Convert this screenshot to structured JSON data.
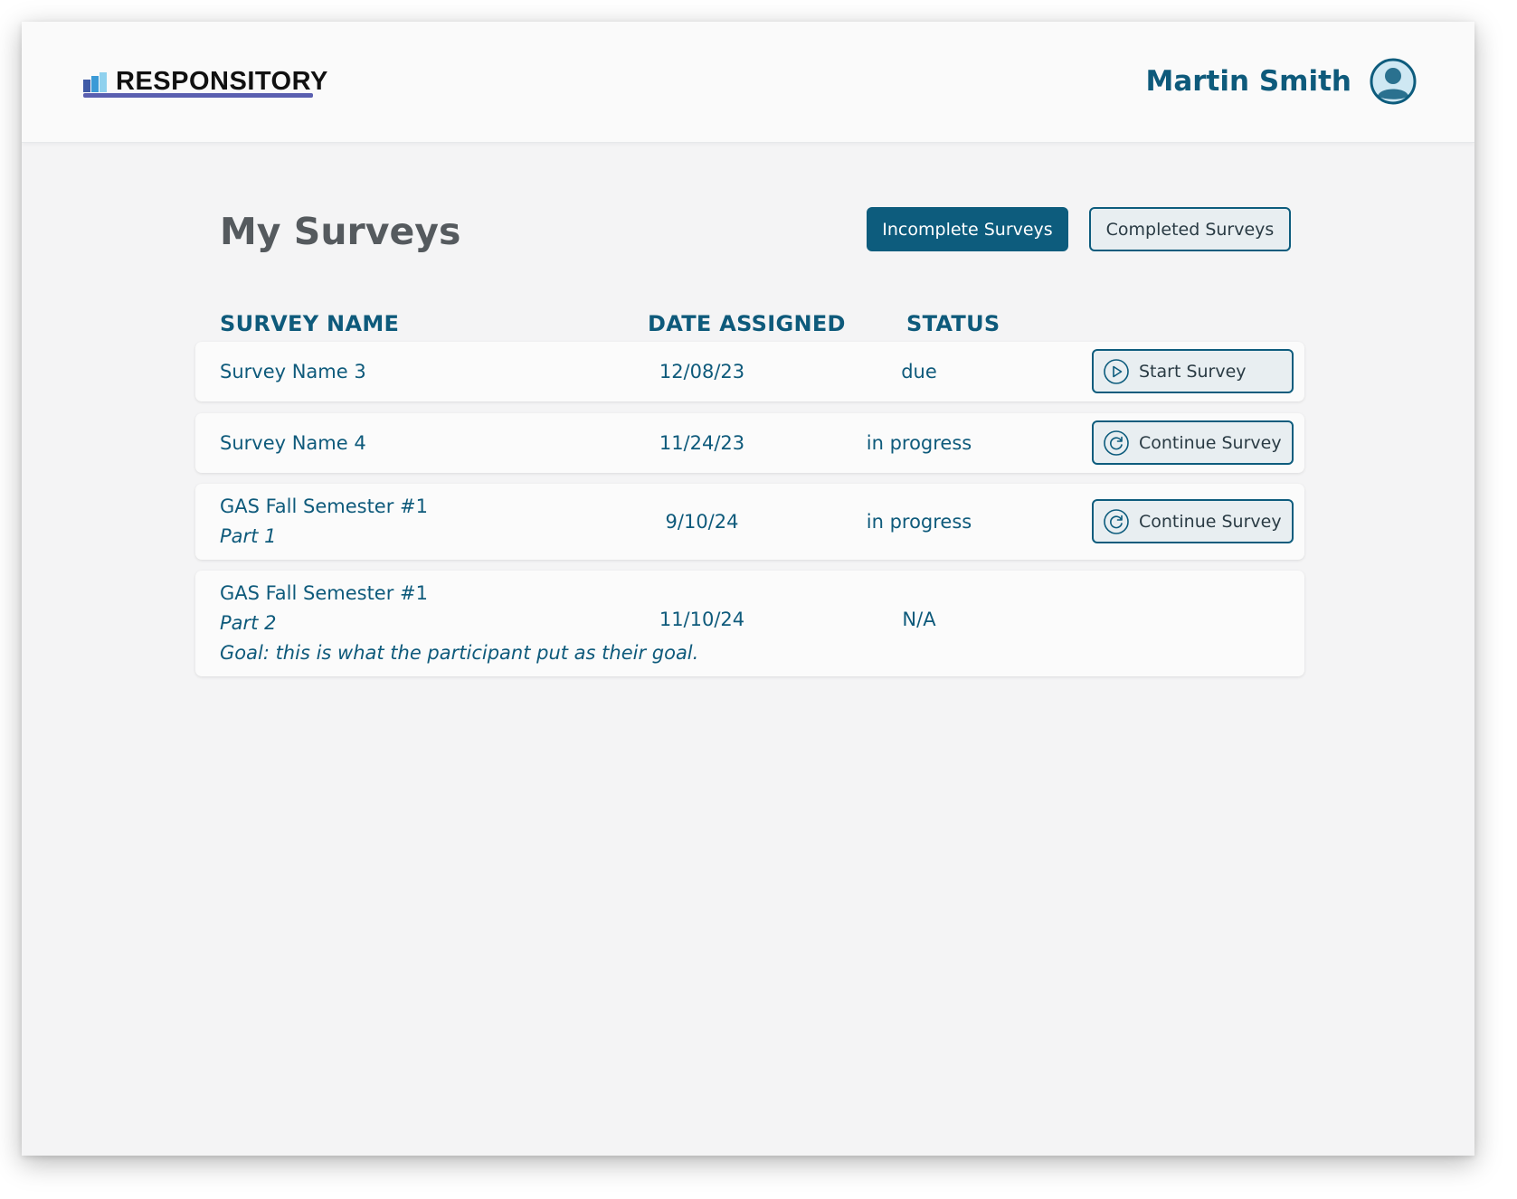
{
  "header": {
    "logo_text": "RESPONSITORY",
    "user_name": "Martin Smith"
  },
  "page": {
    "title": "My Surveys",
    "tabs": [
      {
        "label": "Incomplete Surveys",
        "active": true
      },
      {
        "label": "Completed Surveys",
        "active": false
      }
    ]
  },
  "table": {
    "columns": [
      "SURVEY NAME",
      "DATE ASSIGNED",
      "STATUS"
    ],
    "rows": [
      {
        "name": "Survey Name 3",
        "date": "12/08/23",
        "status": "due",
        "action": "Start Survey",
        "action_icon": "play-circle-icon"
      },
      {
        "name": "Survey Name 4",
        "date": "11/24/23",
        "status": "in progress",
        "action": "Continue Survey",
        "action_icon": "refresh-circle-icon"
      },
      {
        "name": "GAS Fall Semester #1",
        "part": "Part 1",
        "date": "9/10/24",
        "status": "in progress",
        "action": "Continue Survey",
        "action_icon": "refresh-circle-icon"
      },
      {
        "name": "GAS Fall Semester #1",
        "part": "Part 2",
        "goal": "Goal: this is what the participant put as their goal.",
        "date": "11/10/24",
        "status": "N/A"
      }
    ]
  },
  "colors": {
    "primary": "#0d5c7d",
    "text_accent": "#0e5a7b",
    "background": "#f4f4f5"
  }
}
